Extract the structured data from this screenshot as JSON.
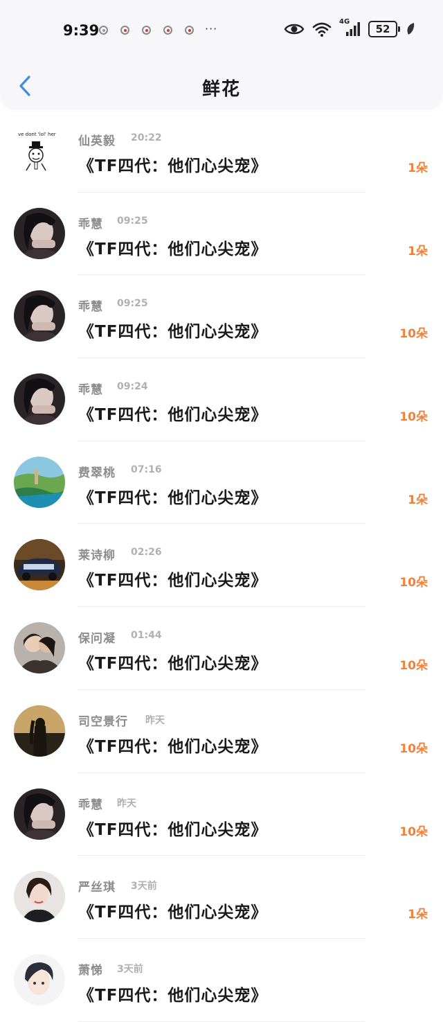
{
  "status_bar": {
    "time": "9:39",
    "more": "···",
    "network": "4G",
    "battery": "52"
  },
  "header": {
    "title": "鲜花"
  },
  "rows": [
    {
      "name": "仙英毅",
      "time": "20:22",
      "book": "《TF四代：他们心尖宠》",
      "amount": "1朵",
      "avatar": "meme-avatar",
      "meme_text": "ve dont 'lol' her"
    },
    {
      "name": "乖慧",
      "time": "09:25",
      "book": "《TF四代：他们心尖宠》",
      "amount": "1朵",
      "avatar": "dark-portrait-avatar"
    },
    {
      "name": "乖慧",
      "time": "09:25",
      "book": "《TF四代：他们心尖宠》",
      "amount": "10朵",
      "avatar": "dark-portrait-avatar"
    },
    {
      "name": "乖慧",
      "time": "09:24",
      "book": "《TF四代：他们心尖宠》",
      "amount": "10朵",
      "avatar": "dark-portrait-avatar"
    },
    {
      "name": "费翠桃",
      "time": "07:16",
      "book": "《TF四代：他们心尖宠》",
      "amount": "1朵",
      "avatar": "landscape-avatar"
    },
    {
      "name": "莱诗柳",
      "time": "02:26",
      "book": "《TF四代：他们心尖宠》",
      "amount": "10朵",
      "avatar": "car-avatar"
    },
    {
      "name": "保问凝",
      "time": "01:44",
      "book": "《TF四代：他们心尖宠》",
      "amount": "10朵",
      "avatar": "couple-avatar"
    },
    {
      "name": "司空景行",
      "time": "昨天",
      "book": "《TF四代：他们心尖宠》",
      "amount": "10朵",
      "avatar": "silhouette-avatar"
    },
    {
      "name": "乖慧",
      "time": "昨天",
      "book": "《TF四代：他们心尖宠》",
      "amount": "10朵",
      "avatar": "dark-portrait-avatar"
    },
    {
      "name": "严丝琪",
      "time": "3天前",
      "book": "《TF四代：他们心尖宠》",
      "amount": "1朵",
      "avatar": "woman-portrait-avatar"
    },
    {
      "name": "萧悌",
      "time": "3天前",
      "book": "《TF四代：他们心尖宠》",
      "amount": "",
      "avatar": "anime-avatar"
    }
  ],
  "colors": {
    "accent_blue": "#3a8de0",
    "amount_orange": "#f0813a",
    "name_gray": "#8c8c8c",
    "time_gray": "#b0b0b0"
  }
}
